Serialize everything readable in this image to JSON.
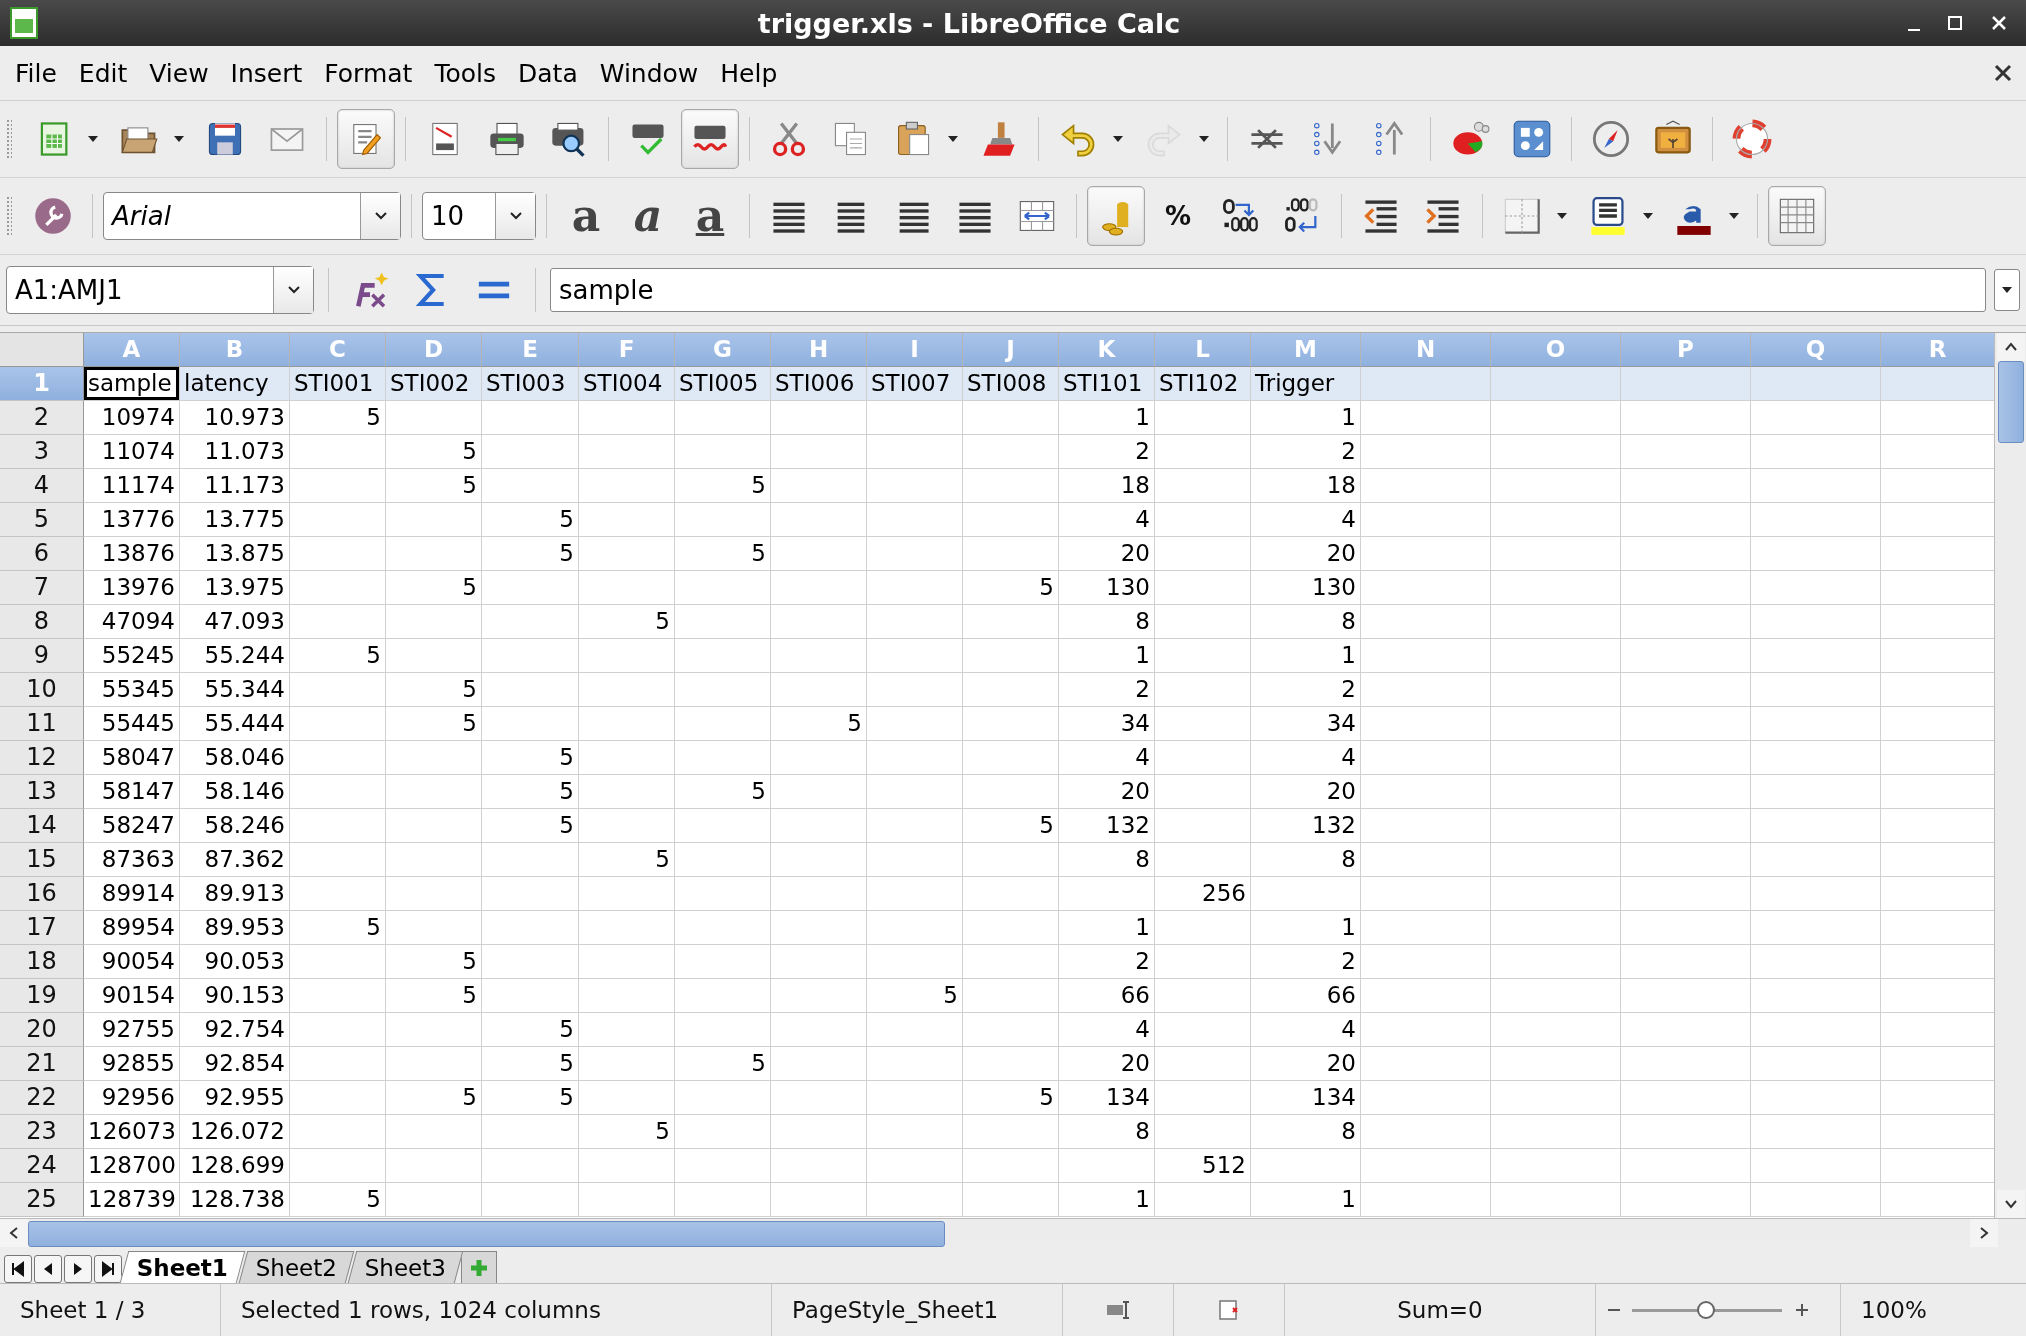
{
  "window": {
    "title": "trigger.xls - LibreOffice Calc"
  },
  "menu": [
    "File",
    "Edit",
    "View",
    "Insert",
    "Format",
    "Tools",
    "Data",
    "Window",
    "Help"
  ],
  "standard_toolbar": [
    {
      "kind": "new",
      "dropdown": true,
      "pressed": false,
      "disabled": false
    },
    {
      "kind": "open",
      "dropdown": true,
      "pressed": false,
      "disabled": false
    },
    {
      "kind": "save",
      "dropdown": false,
      "pressed": false,
      "disabled": false
    },
    {
      "kind": "email",
      "dropdown": false,
      "pressed": false,
      "disabled": false
    },
    {
      "kind": "separator"
    },
    {
      "kind": "edit",
      "dropdown": false,
      "pressed": true,
      "disabled": false
    },
    {
      "kind": "separator"
    },
    {
      "kind": "pdf",
      "dropdown": false,
      "pressed": false,
      "disabled": false
    },
    {
      "kind": "print",
      "dropdown": false,
      "pressed": false,
      "disabled": false
    },
    {
      "kind": "preview",
      "dropdown": false,
      "pressed": false,
      "disabled": false
    },
    {
      "kind": "separator"
    },
    {
      "kind": "spellcheck",
      "dropdown": false,
      "pressed": false,
      "disabled": false
    },
    {
      "kind": "autospell",
      "dropdown": false,
      "pressed": true,
      "disabled": false
    },
    {
      "kind": "separator"
    },
    {
      "kind": "cut",
      "dropdown": false,
      "pressed": false,
      "disabled": false
    },
    {
      "kind": "copy",
      "dropdown": false,
      "pressed": false,
      "disabled": false
    },
    {
      "kind": "paste",
      "dropdown": true,
      "pressed": false,
      "disabled": false
    },
    {
      "kind": "brush",
      "dropdown": false,
      "pressed": false,
      "disabled": false
    },
    {
      "kind": "separator"
    },
    {
      "kind": "undo",
      "dropdown": true,
      "pressed": false,
      "disabled": false
    },
    {
      "kind": "redo",
      "dropdown": true,
      "pressed": false,
      "disabled": true
    },
    {
      "kind": "separator"
    },
    {
      "kind": "link",
      "dropdown": false,
      "pressed": false,
      "disabled": false
    },
    {
      "kind": "sortdown",
      "dropdown": false,
      "pressed": false,
      "disabled": false
    },
    {
      "kind": "sortup",
      "dropdown": false,
      "pressed": false,
      "disabled": false
    },
    {
      "kind": "separator"
    },
    {
      "kind": "chart",
      "dropdown": false,
      "pressed": false,
      "disabled": false
    },
    {
      "kind": "pivot",
      "dropdown": false,
      "pressed": false,
      "disabled": false
    },
    {
      "kind": "separator"
    },
    {
      "kind": "navigator",
      "dropdown": false,
      "pressed": false,
      "disabled": false
    },
    {
      "kind": "gallery",
      "dropdown": false,
      "pressed": false,
      "disabled": false
    },
    {
      "kind": "separator"
    },
    {
      "kind": "help",
      "dropdown": false,
      "pressed": false,
      "disabled": false
    }
  ],
  "formatting_toolbar": {
    "font_name": "Arial",
    "font_size": "10",
    "items": [
      {
        "kind": "bold",
        "glyph": "a",
        "pressed": false
      },
      {
        "kind": "italic",
        "glyph": "a",
        "pressed": false
      },
      {
        "kind": "underline",
        "glyph": "a",
        "pressed": false
      },
      {
        "kind": "separator"
      },
      {
        "kind": "alignleft",
        "pressed": false
      },
      {
        "kind": "aligncenter",
        "pressed": false
      },
      {
        "kind": "alignright",
        "pressed": false
      },
      {
        "kind": "justify",
        "pressed": false
      },
      {
        "kind": "merge",
        "pressed": false
      },
      {
        "kind": "separator"
      },
      {
        "kind": "currency",
        "pressed": true
      },
      {
        "kind": "percent",
        "glyph": "%",
        "pressed": false
      },
      {
        "kind": "adddecimal",
        "pressed": false
      },
      {
        "kind": "deldecimal",
        "pressed": false
      },
      {
        "kind": "separator"
      },
      {
        "kind": "outdent",
        "pressed": false
      },
      {
        "kind": "indent",
        "pressed": false
      },
      {
        "kind": "separator"
      },
      {
        "kind": "borders",
        "pressed": false
      },
      {
        "kind": "bgcolor",
        "pressed": false
      },
      {
        "kind": "fontcolor",
        "pressed": false
      },
      {
        "kind": "separator"
      },
      {
        "kind": "grid",
        "pressed": true
      }
    ]
  },
  "formula_bar": {
    "name_box": "A1:AMJ1",
    "content": "sample"
  },
  "columns": [
    {
      "label": "A",
      "selected": true
    },
    {
      "label": "B",
      "selected": true
    },
    {
      "label": "C",
      "selected": true
    },
    {
      "label": "D",
      "selected": true
    },
    {
      "label": "E",
      "selected": true
    },
    {
      "label": "F",
      "selected": true
    },
    {
      "label": "G",
      "selected": true
    },
    {
      "label": "H",
      "selected": true
    },
    {
      "label": "I",
      "selected": true
    },
    {
      "label": "J",
      "selected": true
    },
    {
      "label": "K",
      "selected": true
    },
    {
      "label": "L",
      "selected": true
    },
    {
      "label": "M",
      "selected": true
    },
    {
      "label": "N",
      "selected": true
    },
    {
      "label": "O",
      "selected": true
    },
    {
      "label": "P",
      "selected": true
    },
    {
      "label": "Q",
      "selected": true
    },
    {
      "label": "R",
      "selected": true
    }
  ],
  "rows": [
    {
      "number": "1",
      "kind": "text",
      "selected": true,
      "cursor": true,
      "cells": [
        "sample",
        "latency",
        "STI001",
        "STI002",
        "STI003",
        "STI004",
        "STI005",
        "STI006",
        "STI007",
        "STI008",
        "STI101",
        "STI102",
        "Trigger"
      ]
    },
    {
      "number": "2",
      "kind": "number",
      "selected": false,
      "cursor": false,
      "cells": [
        "10974",
        "10.973",
        "5",
        null,
        null,
        null,
        null,
        null,
        null,
        null,
        "1",
        null,
        "1"
      ]
    },
    {
      "number": "3",
      "kind": "number",
      "selected": false,
      "cursor": false,
      "cells": [
        "11074",
        "11.073",
        null,
        "5",
        null,
        null,
        null,
        null,
        null,
        null,
        "2",
        null,
        "2"
      ]
    },
    {
      "number": "4",
      "kind": "number",
      "selected": false,
      "cursor": false,
      "cells": [
        "11174",
        "11.173",
        null,
        "5",
        null,
        null,
        "5",
        null,
        null,
        null,
        "18",
        null,
        "18"
      ]
    },
    {
      "number": "5",
      "kind": "number",
      "selected": false,
      "cursor": false,
      "cells": [
        "13776",
        "13.775",
        null,
        null,
        "5",
        null,
        null,
        null,
        null,
        null,
        "4",
        null,
        "4"
      ]
    },
    {
      "number": "6",
      "kind": "number",
      "selected": false,
      "cursor": false,
      "cells": [
        "13876",
        "13.875",
        null,
        null,
        "5",
        null,
        "5",
        null,
        null,
        null,
        "20",
        null,
        "20"
      ]
    },
    {
      "number": "7",
      "kind": "number",
      "selected": false,
      "cursor": false,
      "cells": [
        "13976",
        "13.975",
        null,
        "5",
        null,
        null,
        null,
        null,
        null,
        "5",
        "130",
        null,
        "130"
      ]
    },
    {
      "number": "8",
      "kind": "number",
      "selected": false,
      "cursor": false,
      "cells": [
        "47094",
        "47.093",
        null,
        null,
        null,
        "5",
        null,
        null,
        null,
        null,
        "8",
        null,
        "8"
      ]
    },
    {
      "number": "9",
      "kind": "number",
      "selected": false,
      "cursor": false,
      "cells": [
        "55245",
        "55.244",
        "5",
        null,
        null,
        null,
        null,
        null,
        null,
        null,
        "1",
        null,
        "1"
      ]
    },
    {
      "number": "10",
      "kind": "number",
      "selected": false,
      "cursor": false,
      "cells": [
        "55345",
        "55.344",
        null,
        "5",
        null,
        null,
        null,
        null,
        null,
        null,
        "2",
        null,
        "2"
      ]
    },
    {
      "number": "11",
      "kind": "number",
      "selected": false,
      "cursor": false,
      "cells": [
        "55445",
        "55.444",
        null,
        "5",
        null,
        null,
        null,
        "5",
        null,
        null,
        "34",
        null,
        "34"
      ]
    },
    {
      "number": "12",
      "kind": "number",
      "selected": false,
      "cursor": false,
      "cells": [
        "58047",
        "58.046",
        null,
        null,
        "5",
        null,
        null,
        null,
        null,
        null,
        "4",
        null,
        "4"
      ]
    },
    {
      "number": "13",
      "kind": "number",
      "selected": false,
      "cursor": false,
      "cells": [
        "58147",
        "58.146",
        null,
        null,
        "5",
        null,
        "5",
        null,
        null,
        null,
        "20",
        null,
        "20"
      ]
    },
    {
      "number": "14",
      "kind": "number",
      "selected": false,
      "cursor": false,
      "cells": [
        "58247",
        "58.246",
        null,
        null,
        "5",
        null,
        null,
        null,
        null,
        "5",
        "132",
        null,
        "132"
      ]
    },
    {
      "number": "15",
      "kind": "number",
      "selected": false,
      "cursor": false,
      "cells": [
        "87363",
        "87.362",
        null,
        null,
        null,
        "5",
        null,
        null,
        null,
        null,
        "8",
        null,
        "8"
      ]
    },
    {
      "number": "16",
      "kind": "number",
      "selected": false,
      "cursor": false,
      "cells": [
        "89914",
        "89.913",
        null,
        null,
        null,
        null,
        null,
        null,
        null,
        null,
        null,
        "256",
        null
      ]
    },
    {
      "number": "17",
      "kind": "number",
      "selected": false,
      "cursor": false,
      "cells": [
        "89954",
        "89.953",
        "5",
        null,
        null,
        null,
        null,
        null,
        null,
        null,
        "1",
        null,
        "1"
      ]
    },
    {
      "number": "18",
      "kind": "number",
      "selected": false,
      "cursor": false,
      "cells": [
        "90054",
        "90.053",
        null,
        "5",
        null,
        null,
        null,
        null,
        null,
        null,
        "2",
        null,
        "2"
      ]
    },
    {
      "number": "19",
      "kind": "number",
      "selected": false,
      "cursor": false,
      "cells": [
        "90154",
        "90.153",
        null,
        "5",
        null,
        null,
        null,
        null,
        "5",
        null,
        "66",
        null,
        "66"
      ]
    },
    {
      "number": "20",
      "kind": "number",
      "selected": false,
      "cursor": false,
      "cells": [
        "92755",
        "92.754",
        null,
        null,
        "5",
        null,
        null,
        null,
        null,
        null,
        "4",
        null,
        "4"
      ]
    },
    {
      "number": "21",
      "kind": "number",
      "selected": false,
      "cursor": false,
      "cells": [
        "92855",
        "92.854",
        null,
        null,
        "5",
        null,
        "5",
        null,
        null,
        null,
        "20",
        null,
        "20"
      ]
    },
    {
      "number": "22",
      "kind": "number",
      "selected": false,
      "cursor": false,
      "cells": [
        "92956",
        "92.955",
        null,
        "5",
        "5",
        null,
        null,
        null,
        null,
        "5",
        "134",
        null,
        "134"
      ]
    },
    {
      "number": "23",
      "kind": "number",
      "selected": false,
      "cursor": false,
      "cells": [
        "126073",
        "126.072",
        null,
        null,
        null,
        "5",
        null,
        null,
        null,
        null,
        "8",
        null,
        "8"
      ]
    },
    {
      "number": "24",
      "kind": "number",
      "selected": false,
      "cursor": false,
      "cells": [
        "128700",
        "128.699",
        null,
        null,
        null,
        null,
        null,
        null,
        null,
        null,
        null,
        "512",
        null
      ]
    },
    {
      "number": "25",
      "kind": "number",
      "selected": false,
      "cursor": false,
      "cells": [
        "128739",
        "128.738",
        "5",
        null,
        null,
        null,
        null,
        null,
        null,
        null,
        "1",
        null,
        "1"
      ]
    }
  ],
  "sheet_tabs": [
    {
      "label": "Sheet1",
      "selected": true
    },
    {
      "label": "Sheet2",
      "selected": false
    },
    {
      "label": "Sheet3",
      "selected": false
    }
  ],
  "status_bar": {
    "sheet": "Sheet 1 / 3",
    "selection": "Selected 1 rows, 1024 columns",
    "page_style": "PageStyle_Sheet1",
    "sum": "Sum=0",
    "zoom": {
      "level": 0.49,
      "reading": "100%"
    }
  }
}
